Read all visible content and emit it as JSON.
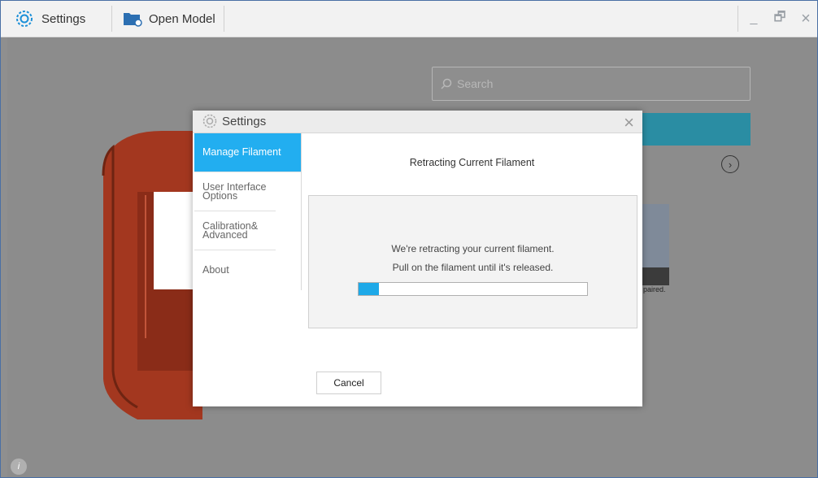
{
  "titlebar": {
    "settings_label": "Settings",
    "open_model_label": "Open Model",
    "controls": {
      "minimize": "_",
      "restore": "🗗",
      "close": "×"
    }
  },
  "workspace": {
    "search_placeholder": "Search",
    "next_arrow": "›",
    "thumbnail_caption": "paired.",
    "info_icon": "i"
  },
  "dialog": {
    "title": "Settings",
    "close": "×",
    "sidebar": {
      "items": [
        {
          "label": "Manage Filament",
          "active": true
        },
        {
          "label": "User Interface Options",
          "active": false
        },
        {
          "label": "Calibration& Advanced",
          "active": false
        },
        {
          "label": "About",
          "active": false
        }
      ]
    },
    "content": {
      "title": "Retracting Current Filament",
      "message_line1": "We're retracting your current filament.",
      "message_line2": "Pull on the filament until it's released.",
      "progress": 0.09,
      "cancel_label": "Cancel"
    }
  },
  "colors": {
    "accent": "#22aef0",
    "model": "#a0361e",
    "teal_banner": "#2a8da3"
  }
}
